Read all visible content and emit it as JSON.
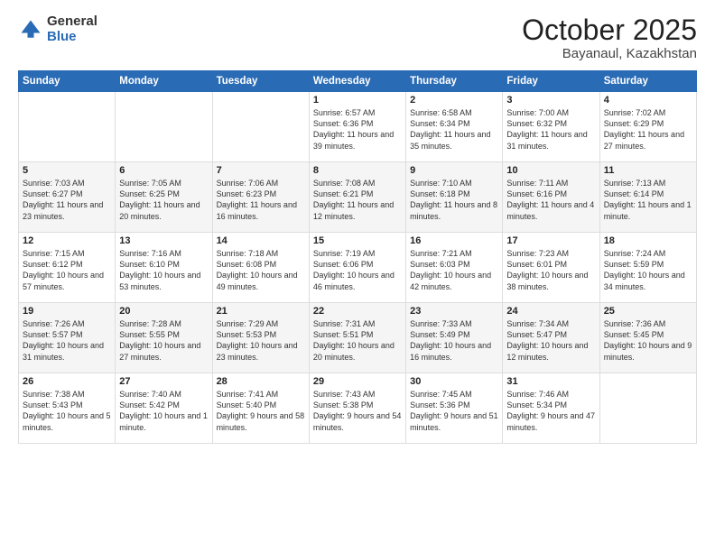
{
  "logo": {
    "general": "General",
    "blue": "Blue"
  },
  "header": {
    "month": "October 2025",
    "location": "Bayanaul, Kazakhstan"
  },
  "weekdays": [
    "Sunday",
    "Monday",
    "Tuesday",
    "Wednesday",
    "Thursday",
    "Friday",
    "Saturday"
  ],
  "weeks": [
    [
      {
        "day": "",
        "sunrise": "",
        "sunset": "",
        "daylight": ""
      },
      {
        "day": "",
        "sunrise": "",
        "sunset": "",
        "daylight": ""
      },
      {
        "day": "",
        "sunrise": "",
        "sunset": "",
        "daylight": ""
      },
      {
        "day": "1",
        "sunrise": "Sunrise: 6:57 AM",
        "sunset": "Sunset: 6:36 PM",
        "daylight": "Daylight: 11 hours and 39 minutes."
      },
      {
        "day": "2",
        "sunrise": "Sunrise: 6:58 AM",
        "sunset": "Sunset: 6:34 PM",
        "daylight": "Daylight: 11 hours and 35 minutes."
      },
      {
        "day": "3",
        "sunrise": "Sunrise: 7:00 AM",
        "sunset": "Sunset: 6:32 PM",
        "daylight": "Daylight: 11 hours and 31 minutes."
      },
      {
        "day": "4",
        "sunrise": "Sunrise: 7:02 AM",
        "sunset": "Sunset: 6:29 PM",
        "daylight": "Daylight: 11 hours and 27 minutes."
      }
    ],
    [
      {
        "day": "5",
        "sunrise": "Sunrise: 7:03 AM",
        "sunset": "Sunset: 6:27 PM",
        "daylight": "Daylight: 11 hours and 23 minutes."
      },
      {
        "day": "6",
        "sunrise": "Sunrise: 7:05 AM",
        "sunset": "Sunset: 6:25 PM",
        "daylight": "Daylight: 11 hours and 20 minutes."
      },
      {
        "day": "7",
        "sunrise": "Sunrise: 7:06 AM",
        "sunset": "Sunset: 6:23 PM",
        "daylight": "Daylight: 11 hours and 16 minutes."
      },
      {
        "day": "8",
        "sunrise": "Sunrise: 7:08 AM",
        "sunset": "Sunset: 6:21 PM",
        "daylight": "Daylight: 11 hours and 12 minutes."
      },
      {
        "day": "9",
        "sunrise": "Sunrise: 7:10 AM",
        "sunset": "Sunset: 6:18 PM",
        "daylight": "Daylight: 11 hours and 8 minutes."
      },
      {
        "day": "10",
        "sunrise": "Sunrise: 7:11 AM",
        "sunset": "Sunset: 6:16 PM",
        "daylight": "Daylight: 11 hours and 4 minutes."
      },
      {
        "day": "11",
        "sunrise": "Sunrise: 7:13 AM",
        "sunset": "Sunset: 6:14 PM",
        "daylight": "Daylight: 11 hours and 1 minute."
      }
    ],
    [
      {
        "day": "12",
        "sunrise": "Sunrise: 7:15 AM",
        "sunset": "Sunset: 6:12 PM",
        "daylight": "Daylight: 10 hours and 57 minutes."
      },
      {
        "day": "13",
        "sunrise": "Sunrise: 7:16 AM",
        "sunset": "Sunset: 6:10 PM",
        "daylight": "Daylight: 10 hours and 53 minutes."
      },
      {
        "day": "14",
        "sunrise": "Sunrise: 7:18 AM",
        "sunset": "Sunset: 6:08 PM",
        "daylight": "Daylight: 10 hours and 49 minutes."
      },
      {
        "day": "15",
        "sunrise": "Sunrise: 7:19 AM",
        "sunset": "Sunset: 6:06 PM",
        "daylight": "Daylight: 10 hours and 46 minutes."
      },
      {
        "day": "16",
        "sunrise": "Sunrise: 7:21 AM",
        "sunset": "Sunset: 6:03 PM",
        "daylight": "Daylight: 10 hours and 42 minutes."
      },
      {
        "day": "17",
        "sunrise": "Sunrise: 7:23 AM",
        "sunset": "Sunset: 6:01 PM",
        "daylight": "Daylight: 10 hours and 38 minutes."
      },
      {
        "day": "18",
        "sunrise": "Sunrise: 7:24 AM",
        "sunset": "Sunset: 5:59 PM",
        "daylight": "Daylight: 10 hours and 34 minutes."
      }
    ],
    [
      {
        "day": "19",
        "sunrise": "Sunrise: 7:26 AM",
        "sunset": "Sunset: 5:57 PM",
        "daylight": "Daylight: 10 hours and 31 minutes."
      },
      {
        "day": "20",
        "sunrise": "Sunrise: 7:28 AM",
        "sunset": "Sunset: 5:55 PM",
        "daylight": "Daylight: 10 hours and 27 minutes."
      },
      {
        "day": "21",
        "sunrise": "Sunrise: 7:29 AM",
        "sunset": "Sunset: 5:53 PM",
        "daylight": "Daylight: 10 hours and 23 minutes."
      },
      {
        "day": "22",
        "sunrise": "Sunrise: 7:31 AM",
        "sunset": "Sunset: 5:51 PM",
        "daylight": "Daylight: 10 hours and 20 minutes."
      },
      {
        "day": "23",
        "sunrise": "Sunrise: 7:33 AM",
        "sunset": "Sunset: 5:49 PM",
        "daylight": "Daylight: 10 hours and 16 minutes."
      },
      {
        "day": "24",
        "sunrise": "Sunrise: 7:34 AM",
        "sunset": "Sunset: 5:47 PM",
        "daylight": "Daylight: 10 hours and 12 minutes."
      },
      {
        "day": "25",
        "sunrise": "Sunrise: 7:36 AM",
        "sunset": "Sunset: 5:45 PM",
        "daylight": "Daylight: 10 hours and 9 minutes."
      }
    ],
    [
      {
        "day": "26",
        "sunrise": "Sunrise: 7:38 AM",
        "sunset": "Sunset: 5:43 PM",
        "daylight": "Daylight: 10 hours and 5 minutes."
      },
      {
        "day": "27",
        "sunrise": "Sunrise: 7:40 AM",
        "sunset": "Sunset: 5:42 PM",
        "daylight": "Daylight: 10 hours and 1 minute."
      },
      {
        "day": "28",
        "sunrise": "Sunrise: 7:41 AM",
        "sunset": "Sunset: 5:40 PM",
        "daylight": "Daylight: 9 hours and 58 minutes."
      },
      {
        "day": "29",
        "sunrise": "Sunrise: 7:43 AM",
        "sunset": "Sunset: 5:38 PM",
        "daylight": "Daylight: 9 hours and 54 minutes."
      },
      {
        "day": "30",
        "sunrise": "Sunrise: 7:45 AM",
        "sunset": "Sunset: 5:36 PM",
        "daylight": "Daylight: 9 hours and 51 minutes."
      },
      {
        "day": "31",
        "sunrise": "Sunrise: 7:46 AM",
        "sunset": "Sunset: 5:34 PM",
        "daylight": "Daylight: 9 hours and 47 minutes."
      },
      {
        "day": "",
        "sunrise": "",
        "sunset": "",
        "daylight": ""
      }
    ]
  ]
}
